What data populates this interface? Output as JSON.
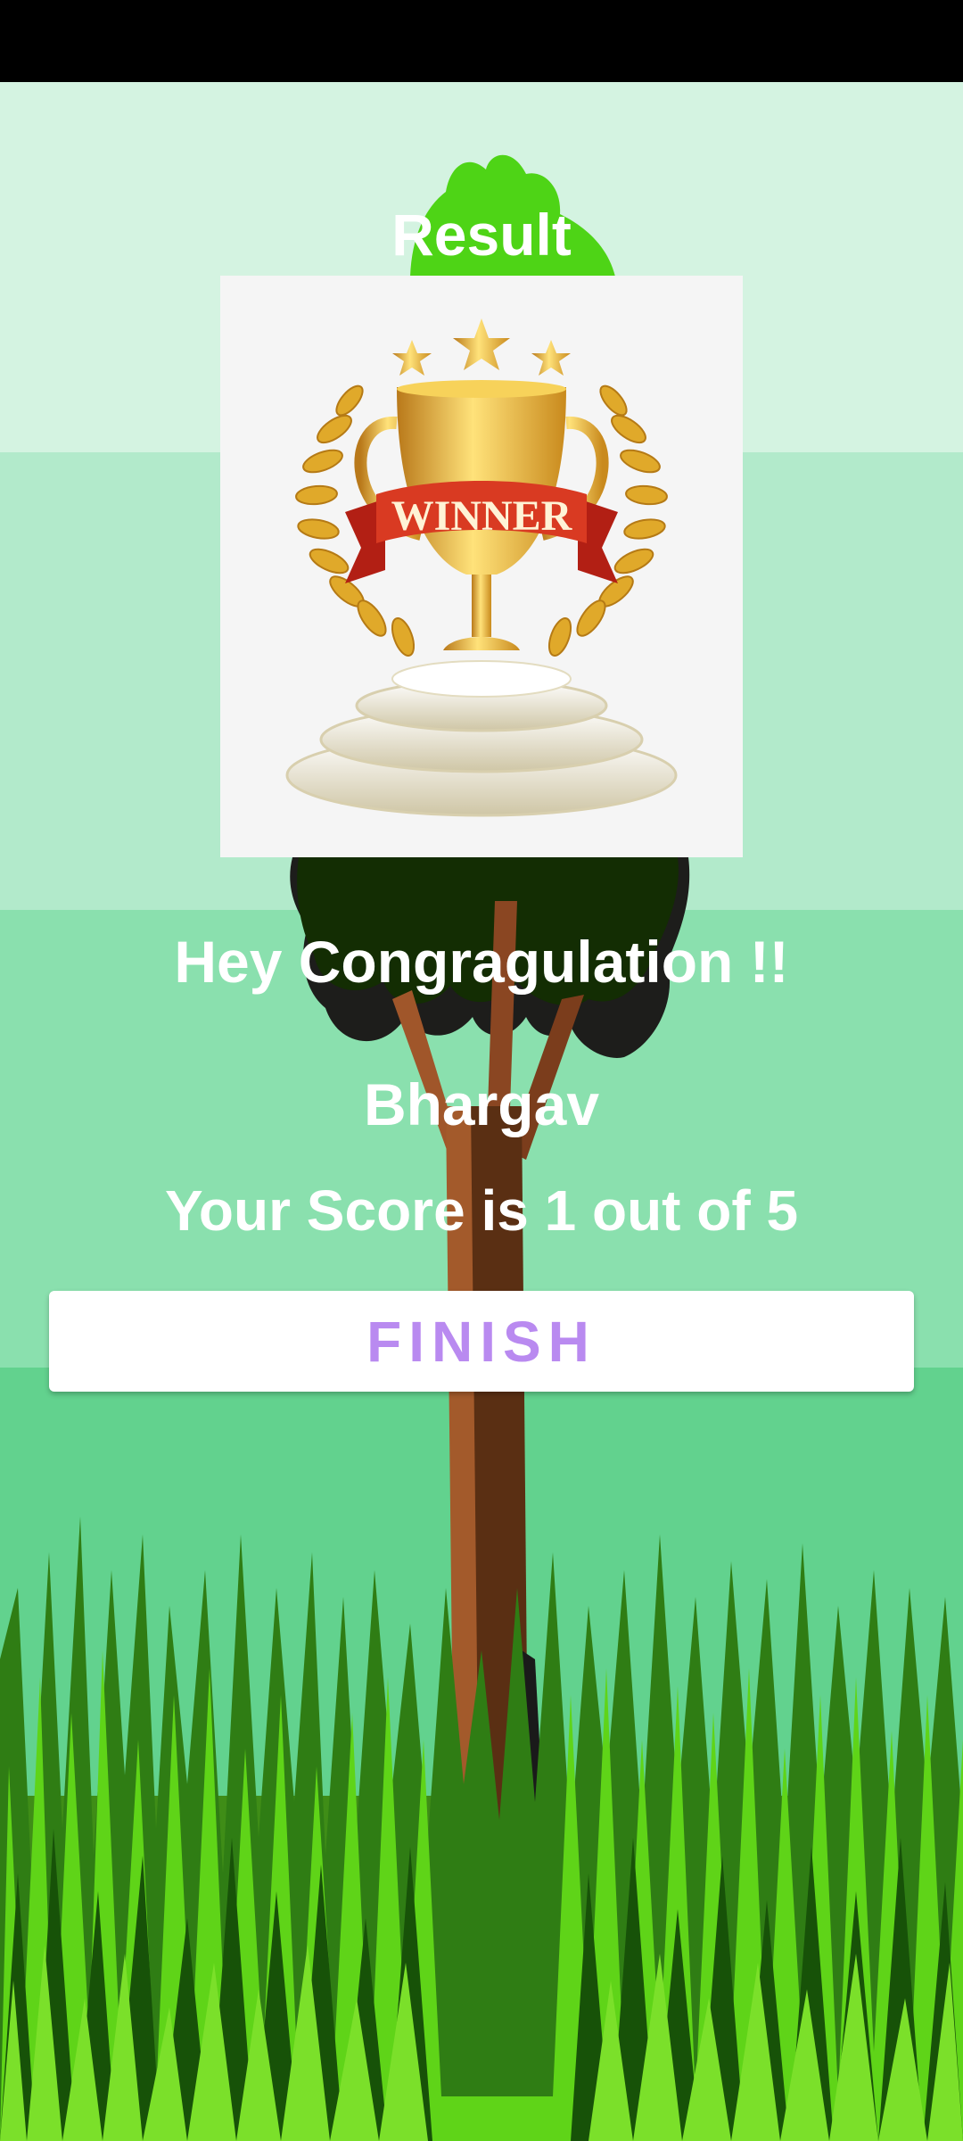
{
  "result": {
    "title": "Result",
    "congratulation": "Hey Congragulation !!",
    "player_name": "Bhargav",
    "score_text": "Your Score is 1 out of 5",
    "finish_label": "FINISH"
  },
  "trophy": {
    "ribbon_text": "WINNER",
    "icon": "winner-trophy-icon"
  },
  "colors": {
    "status_bar": "#000000",
    "band_1": "#d4f3e1",
    "band_2": "#b2eacb",
    "band_3": "#8ae0ae",
    "band_4": "#62d28e",
    "grass": "#3f8d17",
    "button_text": "#b98af0"
  }
}
